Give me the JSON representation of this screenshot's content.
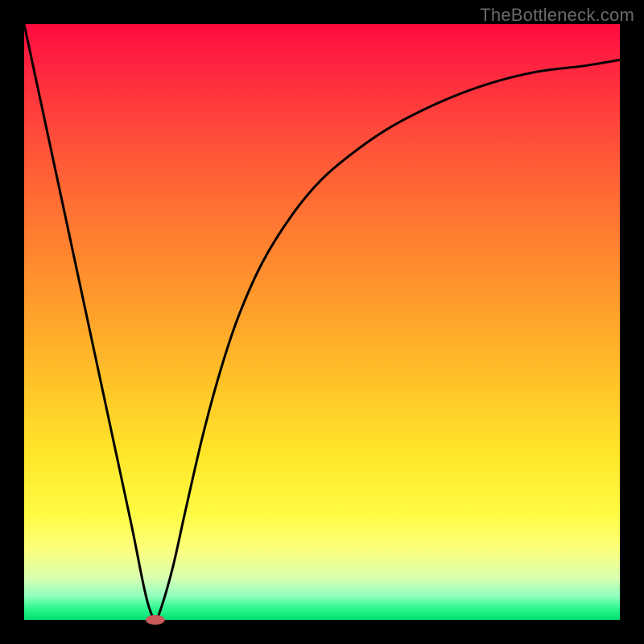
{
  "watermark": "TheBottleneck.com",
  "chart_data": {
    "type": "line",
    "title": "",
    "xlabel": "",
    "ylabel": "",
    "xlim": [
      0,
      100
    ],
    "ylim": [
      0,
      100
    ],
    "series": [
      {
        "name": "curve",
        "x": [
          0,
          3,
          6,
          9,
          12,
          15,
          18,
          20,
          21,
          22,
          23,
          25,
          27,
          30,
          33,
          36,
          40,
          45,
          50,
          56,
          62,
          70,
          78,
          86,
          94,
          100
        ],
        "y": [
          100,
          86,
          72,
          58,
          44,
          30,
          16,
          6,
          2,
          0,
          2,
          9,
          18,
          31,
          42,
          51,
          60,
          68,
          74,
          79,
          83,
          87,
          90,
          92,
          93,
          94
        ]
      }
    ],
    "marker": {
      "x": 22,
      "y": 0,
      "color": "#c85a5a"
    },
    "gradient_stops": [
      {
        "pos": 0.0,
        "color": "#ff0a3e"
      },
      {
        "pos": 0.5,
        "color": "#ffb028"
      },
      {
        "pos": 0.82,
        "color": "#fffb42"
      },
      {
        "pos": 1.0,
        "color": "#00e070"
      }
    ]
  }
}
